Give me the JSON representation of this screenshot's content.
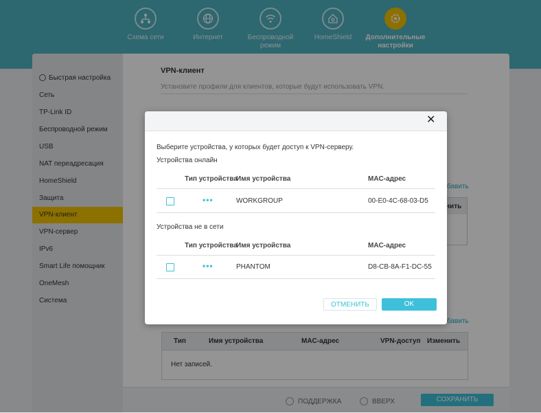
{
  "top_nav": [
    {
      "label": "Схема сети",
      "icon": "network-map-icon"
    },
    {
      "label": "Интернет",
      "icon": "globe-icon"
    },
    {
      "label": "Беспроводной режим",
      "icon": "wifi-icon"
    },
    {
      "label": "HomeShield",
      "icon": "home-shield-icon"
    },
    {
      "label": "Дополнительные настройки",
      "icon": "advanced-gear-icon",
      "active": true
    }
  ],
  "sidebar": {
    "items": [
      {
        "label": "Быстрая настройка"
      },
      {
        "label": "Сеть"
      },
      {
        "label": "TP-Link ID"
      },
      {
        "label": "Беспроводной режим"
      },
      {
        "label": "USB"
      },
      {
        "label": "NAT переадресация"
      },
      {
        "label": "HomeShield"
      },
      {
        "label": "Защита"
      },
      {
        "label": "VPN-клиент",
        "active": true
      },
      {
        "label": "VPN-сервер"
      },
      {
        "label": "IPv6"
      },
      {
        "label": "Smart Life помощник"
      },
      {
        "label": "OneMesh"
      },
      {
        "label": "Система"
      }
    ]
  },
  "main": {
    "title": "VPN-клиент",
    "subtitle": "Установите профили для клиентов, которые будут использовать VPN.",
    "add_link_fragment_1": "бавить",
    "header_fragment": "нить",
    "add_link_fragment_2": "бавить",
    "access_table": {
      "headers": [
        "Тип",
        "Имя устройства",
        "MAC-адрес",
        "VPN-доступ",
        "Изменить"
      ],
      "empty_text": "Нет записей."
    }
  },
  "footer": {
    "support": "ПОДДЕРЖКА",
    "top": "ВВЕРХ",
    "save": "СОХРАНИТЬ"
  },
  "modal": {
    "close_symbol": "✕",
    "instruction": "Выберите устройства, у которых будет доступ к VPN-серверу.",
    "online_title": "Устройства онлайн",
    "offline_title": "Устройства не в сети",
    "headers": {
      "type": "Тип устройства",
      "name": "Имя устройства",
      "mac": "MAC-адрес"
    },
    "online_devices": [
      {
        "type_symbol": "•••",
        "name": "WORKGROUP",
        "mac": "00-E0-4C-68-03-D5",
        "checked": false
      }
    ],
    "offline_devices": [
      {
        "type_symbol": "•••",
        "name": "PHANTOM",
        "mac": "D8-CB-8A-F1-DC-55",
        "checked": false
      }
    ],
    "cancel": "ОТМЕНИТЬ",
    "ok": "OK"
  },
  "colors": {
    "accent": "#3ec0da",
    "header_bg": "#4fb1c2",
    "active_yellow": "#f2c200"
  }
}
